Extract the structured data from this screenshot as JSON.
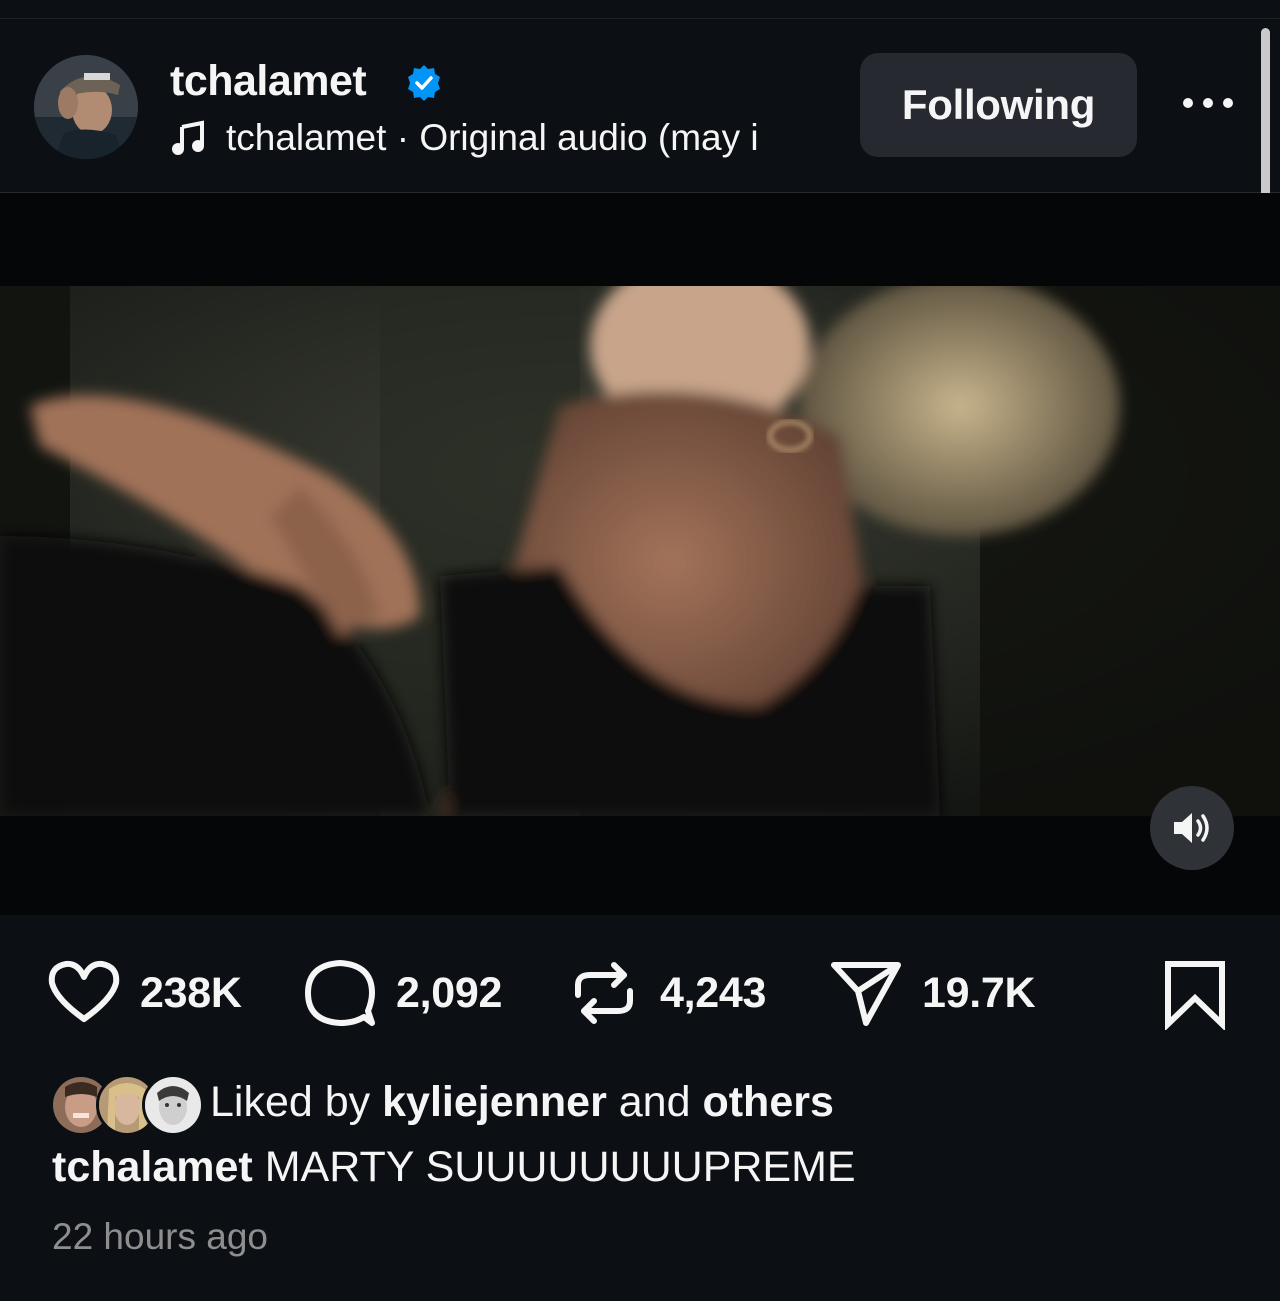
{
  "post": {
    "username": "tchalamet",
    "verified": true,
    "audio": {
      "artist": "tchalamet",
      "separator": " · ",
      "title": "Original audio  (may i"
    },
    "follow_label": "Following"
  },
  "stats": {
    "likes": "238K",
    "comments": "2,092",
    "reposts": "4,243",
    "shares": "19.7K"
  },
  "likes_summary": {
    "prefix": "Liked by",
    "user": "kyliejenner",
    "connector": "and",
    "others": "others"
  },
  "caption": {
    "username": "tchalamet",
    "text": "MARTY SUUUUUUUUPREME"
  },
  "timestamp": "22 hours ago",
  "icons": {
    "verified": "verified-badge-icon",
    "music": "music-note-icon",
    "more": "more-options-icon",
    "mute": "speaker-icon",
    "like": "heart-icon",
    "comment": "comment-icon",
    "repost": "repost-icon",
    "share": "share-icon",
    "save": "bookmark-icon"
  },
  "colors": {
    "background": "#0c1014",
    "verified": "#0095f6",
    "button": "#262a30",
    "muted_text": "#8e8e8e"
  }
}
